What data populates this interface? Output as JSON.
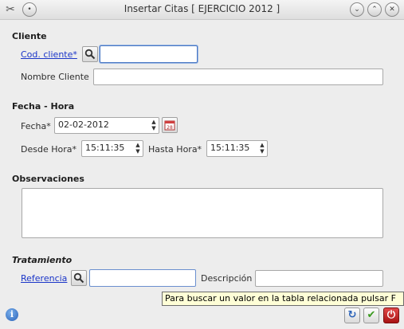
{
  "window": {
    "title": "Insertar Citas [ EJERCICIO 2012 ]",
    "app_icon": "tools-icon",
    "controls": [
      "minimize-icon",
      "maximize-icon",
      "close-icon"
    ]
  },
  "cliente": {
    "section_label": "Cliente",
    "cod_cliente_link": "Cod. cliente*",
    "cod_cliente_value": "",
    "nombre_label": "Nombre Cliente",
    "nombre_value": ""
  },
  "fecha_hora": {
    "section_label": "Fecha - Hora",
    "fecha_label": "Fecha*",
    "fecha_value": "02-02-2012",
    "desde_label": "Desde Hora*",
    "desde_value": "15:11:35",
    "hasta_label": "Hasta Hora*",
    "hasta_value": "15:11:35"
  },
  "observaciones": {
    "section_label": "Observaciones",
    "value": ""
  },
  "tratamiento": {
    "section_label": "Tratamiento",
    "referencia_link": "Referencia",
    "referencia_value": "",
    "descripcion_label": "Descripción",
    "descripcion_value": ""
  },
  "tooltip": {
    "text": "Para buscar un valor en la tabla relacionada pulsar F"
  },
  "colors": {
    "link": "#1a35c8",
    "tooltip_bg": "#fefed6",
    "focus_border": "#4a78c4",
    "cancel_red": "#c81e1e",
    "accept_green": "#3a9a1e"
  }
}
